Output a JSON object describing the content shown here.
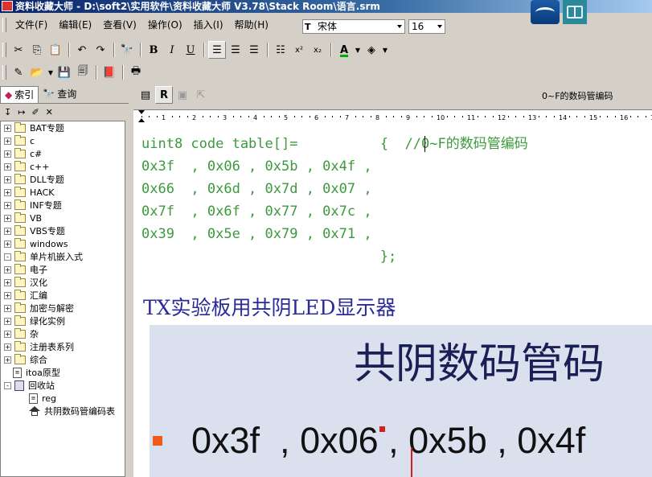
{
  "window": {
    "title": "资料收藏大师 - D:\\soft2\\实用软件\\资料收藏大师 V3.78\\Stack Room\\语言.srm"
  },
  "menu": [
    "文件(F)",
    "编辑(E)",
    "查看(V)",
    "操作(O)",
    "插入(I)",
    "帮助(H)"
  ],
  "format": {
    "font_name": "宋体",
    "font_icon_label": "T",
    "font_size": "16"
  },
  "left_panel": {
    "tabs": [
      "索引",
      "查询"
    ],
    "tree": [
      {
        "label": "BAT专题",
        "type": "folder",
        "expander": "+"
      },
      {
        "label": "c",
        "type": "folder",
        "expander": "+"
      },
      {
        "label": "c#",
        "type": "folder",
        "expander": "+"
      },
      {
        "label": "c++",
        "type": "folder",
        "expander": "+"
      },
      {
        "label": "DLL专题",
        "type": "folder",
        "expander": "+"
      },
      {
        "label": "HACK",
        "type": "folder",
        "expander": "+"
      },
      {
        "label": "INF专题",
        "type": "folder",
        "expander": "+"
      },
      {
        "label": "VB",
        "type": "folder",
        "expander": "+"
      },
      {
        "label": "VBS专题",
        "type": "folder",
        "expander": "+"
      },
      {
        "label": "windows",
        "type": "folder",
        "expander": "+"
      },
      {
        "label": "单片机嵌入式",
        "type": "folder",
        "expander": "-"
      },
      {
        "label": "电子",
        "type": "folder",
        "expander": "+"
      },
      {
        "label": "汉化",
        "type": "folder",
        "expander": "+"
      },
      {
        "label": "汇编",
        "type": "folder",
        "expander": "+"
      },
      {
        "label": "加密与解密",
        "type": "folder",
        "expander": "+"
      },
      {
        "label": "绿化实例",
        "type": "folder",
        "expander": "+"
      },
      {
        "label": "杂",
        "type": "folder",
        "expander": "+"
      },
      {
        "label": "注册表系列",
        "type": "folder",
        "expander": "+"
      },
      {
        "label": "综合",
        "type": "folder",
        "expander": "+"
      },
      {
        "label": "itoa原型",
        "type": "doc",
        "expander": ""
      },
      {
        "label": "回收站",
        "type": "bin",
        "expander": "-"
      },
      {
        "label": "reg",
        "type": "doc",
        "expander": "",
        "indent": true
      },
      {
        "label": "共阴数码管编码表",
        "type": "home",
        "expander": "",
        "indent": true
      }
    ]
  },
  "document": {
    "title": "0~F的数码管编码",
    "code_lines": [
      "uint8 code table[]=          {  //0~F的数码管编码",
      "0x3f  , 0x06 , 0x5b , 0x4f ,",
      "0x66  , 0x6d , 0x7d , 0x07 ,",
      "0x7f  , 0x6f , 0x77 , 0x7c ,",
      "0x39  , 0x5e , 0x79 , 0x71 ,",
      "                             };"
    ],
    "heading": "TX实验板用共阴LED显示器",
    "image": {
      "title": "共阴数码管码",
      "values": "0x3f  , 0x06 , 0x5b , 0x4f"
    }
  },
  "colors": {
    "code": "#3c9a3c",
    "heading": "#2a2a9a",
    "title_bar": "#0a246a"
  }
}
